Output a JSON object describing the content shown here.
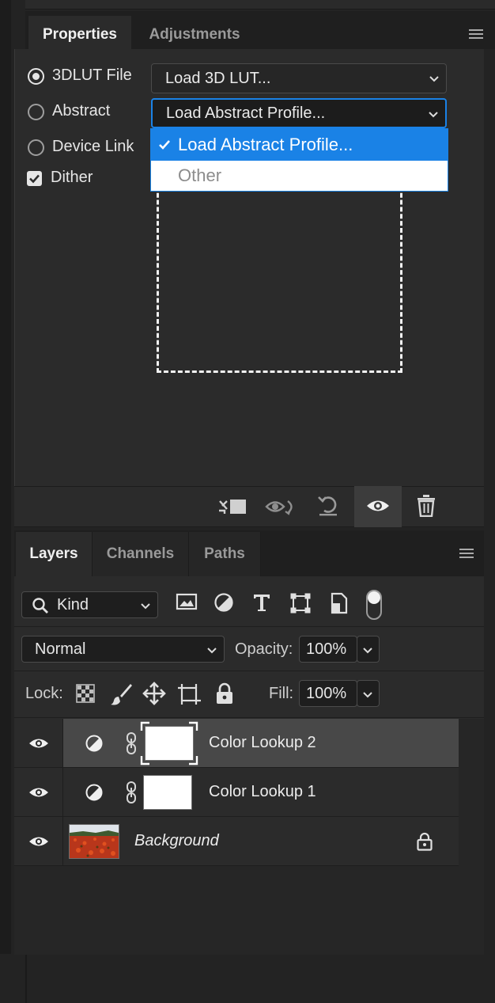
{
  "colors": {
    "panel_bg": "#2b2b2b",
    "accent_blue": "#1a82e6",
    "text": "#e6e6e6",
    "selected_row": "#484848"
  },
  "properties_panel": {
    "tabs": [
      {
        "label": "Properties",
        "active": true
      },
      {
        "label": "Adjustments",
        "active": false
      }
    ],
    "menu_icon": "panel-menu-icon",
    "options": [
      {
        "label": "3DLUT File",
        "selected": true
      },
      {
        "label": "Abstract",
        "selected": false
      },
      {
        "label": "Device Link",
        "selected": false
      }
    ],
    "dither": {
      "label": "Dither",
      "checked": true
    },
    "dropdown_3dlut": {
      "value": "Load 3D LUT..."
    },
    "dropdown_abstract": {
      "value": "Load Abstract Profile...",
      "open": true,
      "options": [
        {
          "label": "Load Abstract Profile...",
          "checked": true
        },
        {
          "label": "Other",
          "checked": false
        }
      ]
    },
    "footer_icons": [
      "clip-to-layer-icon",
      "view-previous-state-icon",
      "reset-icon",
      "visibility-eye-icon",
      "trash-icon"
    ]
  },
  "layers_panel": {
    "tabs": [
      {
        "label": "Layers",
        "active": true
      },
      {
        "label": "Channels",
        "active": false
      },
      {
        "label": "Paths",
        "active": false
      }
    ],
    "filter": {
      "kind_label": "Kind",
      "icons": [
        "image-filter-icon",
        "adjustment-filter-icon",
        "type-filter-icon",
        "shape-filter-icon",
        "smart-object-filter-icon",
        "filter-toggle-icon"
      ]
    },
    "blend_mode": "Normal",
    "opacity": {
      "label": "Opacity:",
      "value": "100%"
    },
    "lock": {
      "label": "Lock:",
      "icons": [
        "lock-transparent-pixels-icon",
        "lock-image-pixels-icon",
        "lock-position-icon",
        "lock-artboard-icon",
        "lock-all-icon"
      ]
    },
    "fill": {
      "label": "Fill:",
      "value": "100%"
    },
    "layers": [
      {
        "name": "Color Lookup 2",
        "type": "adjustment",
        "selected": true,
        "visible": true
      },
      {
        "name": "Color Lookup 1",
        "type": "adjustment",
        "selected": false,
        "visible": true
      },
      {
        "name": "Background",
        "type": "image",
        "selected": false,
        "visible": true,
        "locked": true
      }
    ]
  }
}
